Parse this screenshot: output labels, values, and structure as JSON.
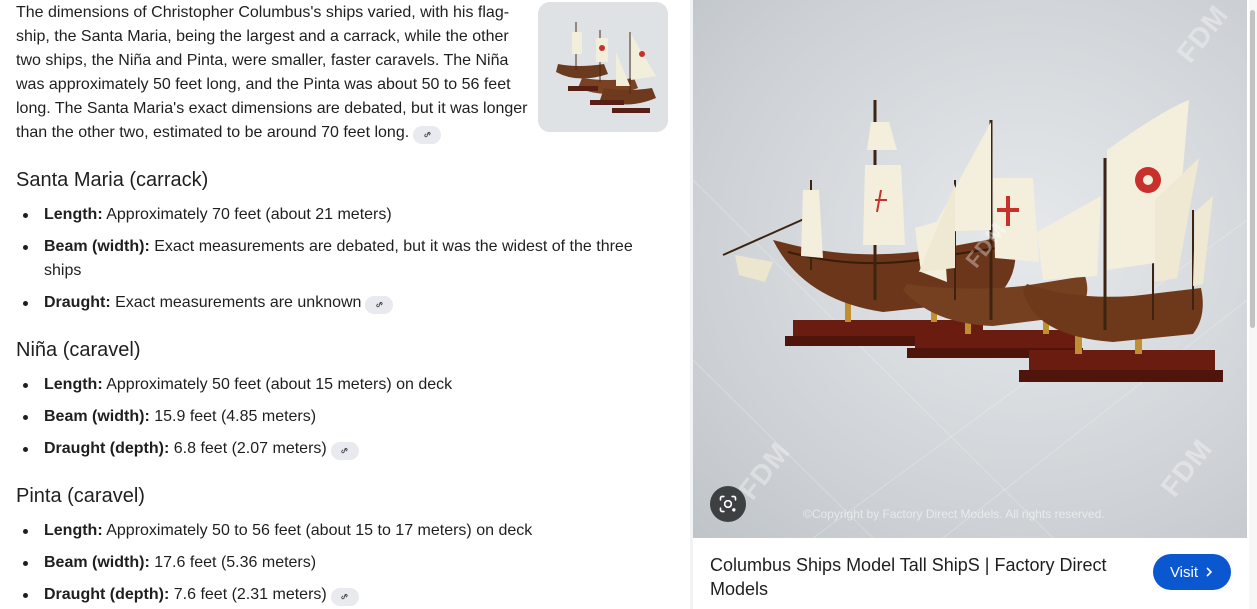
{
  "intro": {
    "text": "The dimensions of Christopher Columbus's ships varied, with his flag-ship, the Santa Maria, being the largest and a carrack, while the other two ships, the Niña and Pinta, were smaller, faster caravels. The Niña was approximately 50 feet long, and the Pinta was about 50 to 56 feet long. The Santa Maria's exact dimensions are debated, but it was longer than the other two, estimated to be around 70 feet long."
  },
  "sections": [
    {
      "title": "Santa Maria (carrack)",
      "items": [
        {
          "label": "Length:",
          "value": " Approximately 70 feet (about 21 meters)"
        },
        {
          "label": "Beam (width):",
          "value": " Exact measurements are debated, but it was the widest of the three ships"
        },
        {
          "label": "Draught:",
          "value": " Exact measurements are unknown"
        }
      ]
    },
    {
      "title": "Niña (caravel)",
      "items": [
        {
          "label": "Length:",
          "value": " Approximately 50 feet (about 15 meters) on deck"
        },
        {
          "label": "Beam (width):",
          "value": " 15.9 feet (4.85 meters)"
        },
        {
          "label": "Draught (depth):",
          "value": " 6.8 feet (2.07 meters)"
        }
      ]
    },
    {
      "title": "Pinta (caravel)",
      "items": [
        {
          "label": "Length:",
          "value": " Approximately 50 to 56 feet (about 15 to 17 meters) on deck"
        },
        {
          "label": "Beam (width):",
          "value": " 17.6 feet (5.36 meters)"
        },
        {
          "label": "Draught (depth):",
          "value": " 7.6 feet (2.31 meters)"
        }
      ]
    }
  ],
  "image_panel": {
    "copyright": "©Copyright by Factory Direct Models. All rights reserved.",
    "watermark": "FDM",
    "source_title": "Columbus Ships Model Tall ShipS | Factory Direct Models",
    "visit_label": "Visit"
  },
  "icons": {
    "link": "link-icon",
    "lens": "google-lens-icon",
    "visit_arrow": "chevron-right-icon"
  },
  "colors": {
    "accent": "#0b57d0",
    "chip_bg": "#e8eaf0",
    "text": "#1f1f1f"
  }
}
